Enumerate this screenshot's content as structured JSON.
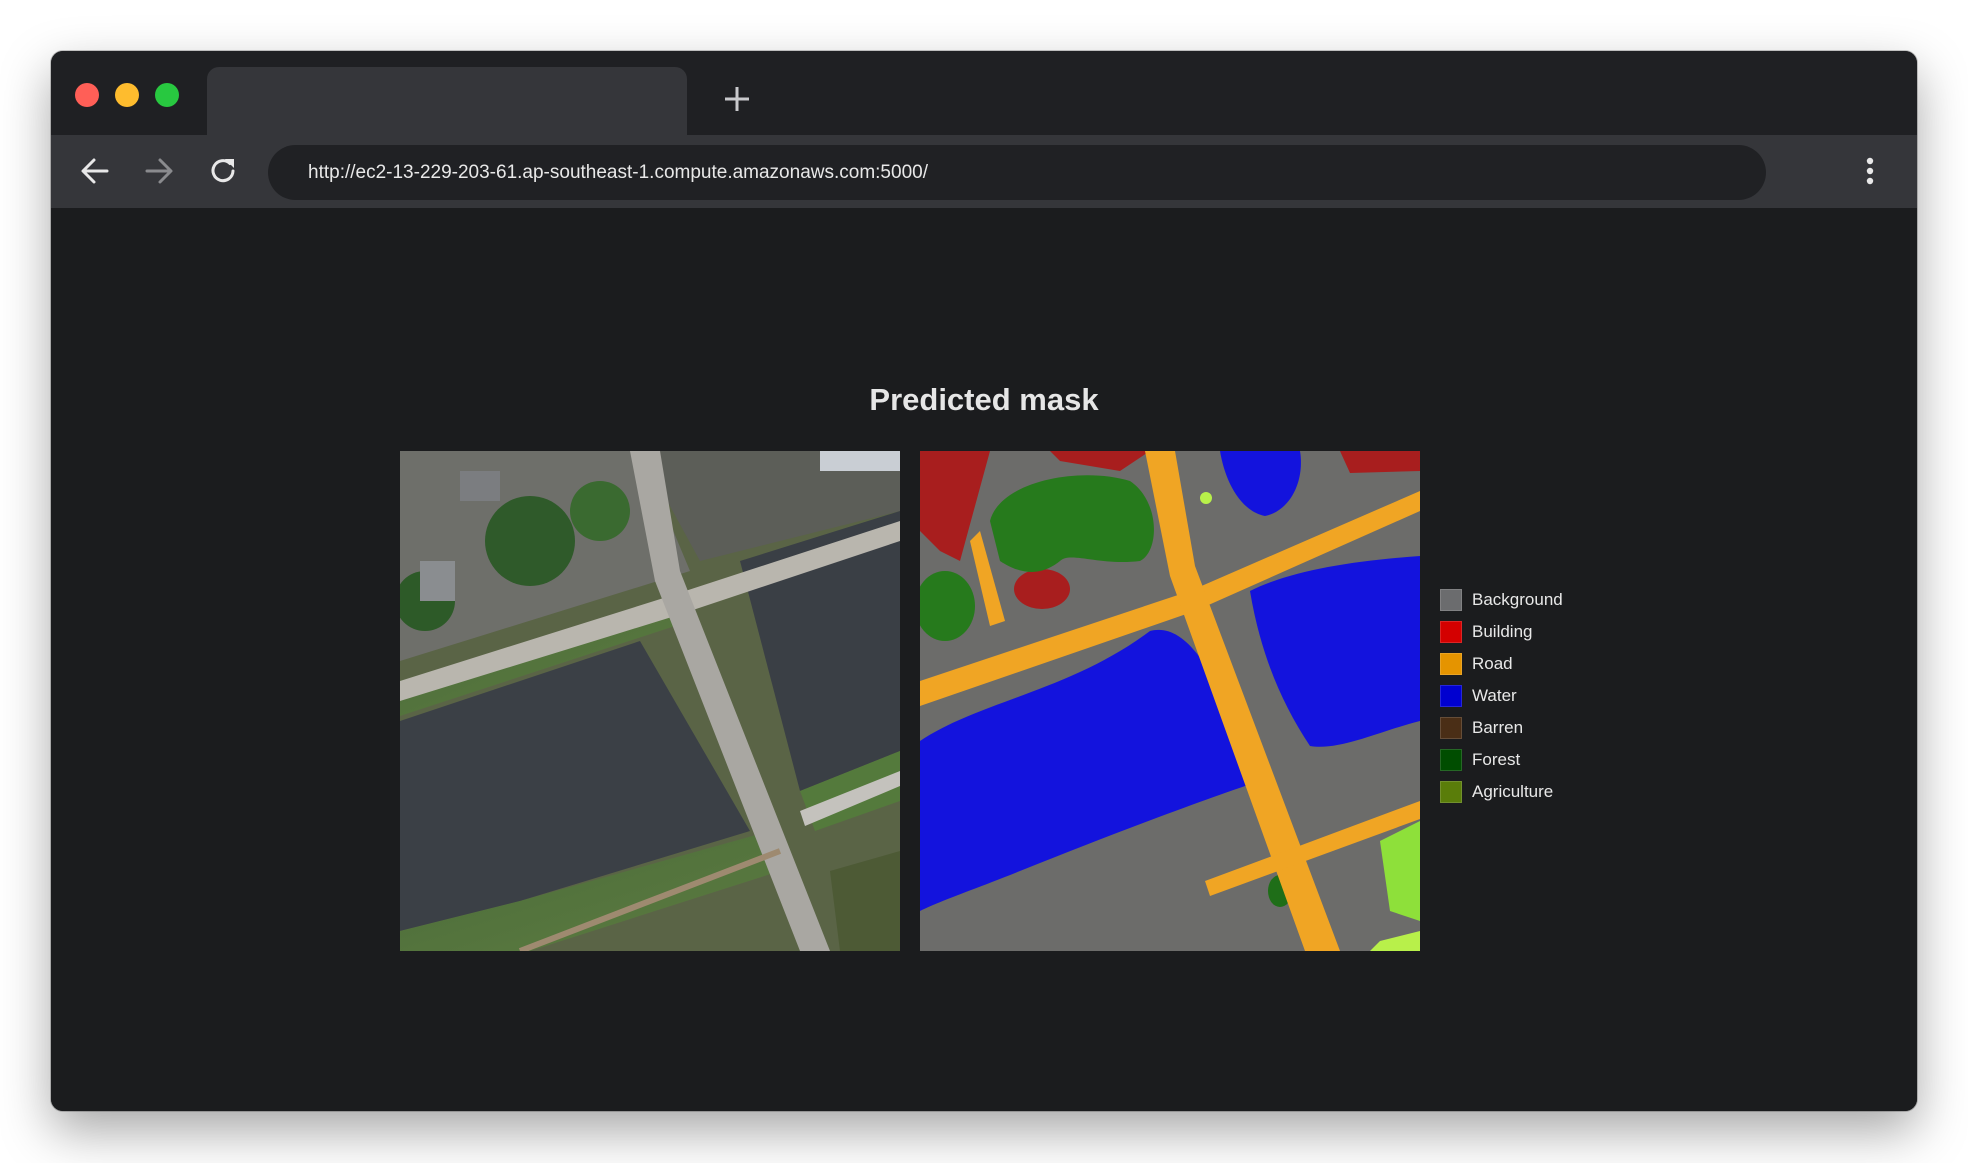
{
  "window": {
    "traffic_lights": [
      "#ff5f57",
      "#febc2e",
      "#28c840"
    ]
  },
  "toolbar": {
    "url": "http://ec2-13-229-203-61.ap-southeast-1.compute.amazonaws.com:5000/",
    "back_icon": "arrow-left-icon",
    "forward_icon": "arrow-right-icon",
    "reload_icon": "reload-icon",
    "menu_icon": "kebab-menu-icon"
  },
  "main": {
    "title": "Predicted mask",
    "legend": [
      {
        "label": "Background",
        "color": "#6b6c6e"
      },
      {
        "label": "Building",
        "color": "#d40000"
      },
      {
        "label": "Road",
        "color": "#e59400"
      },
      {
        "label": "Water",
        "color": "#0000d0"
      },
      {
        "label": "Barren",
        "color": "#4a2e16"
      },
      {
        "label": "Forest",
        "color": "#004d00"
      },
      {
        "label": "Agriculture",
        "color": "#5a7d0a"
      }
    ]
  }
}
